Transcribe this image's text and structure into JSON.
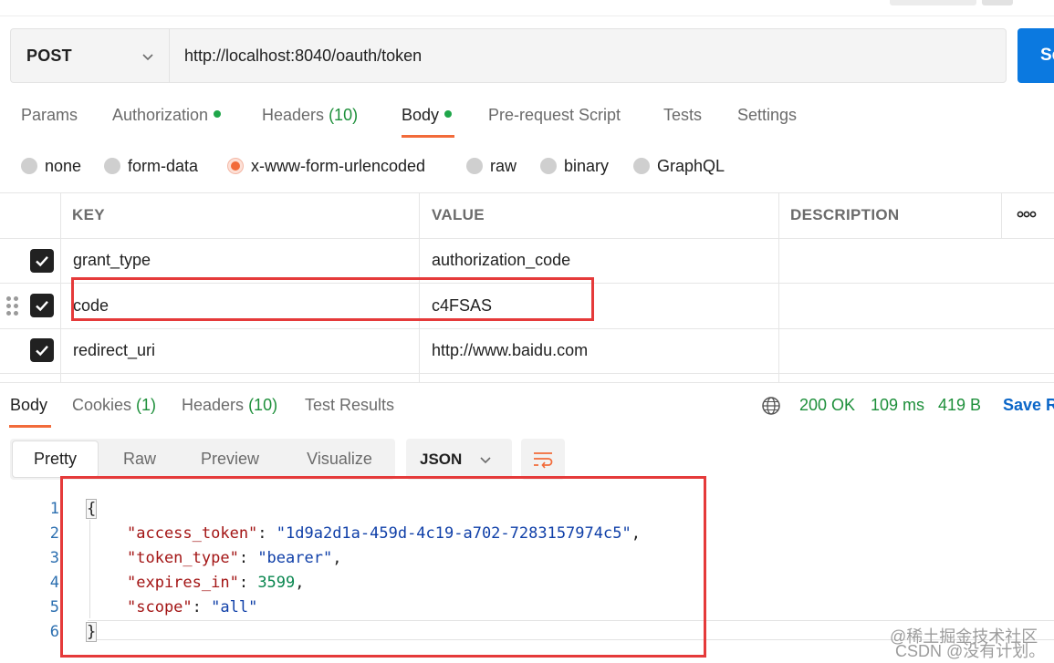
{
  "request": {
    "method": "POST",
    "url": "http://localhost:8040/oauth/token",
    "send_label": "Se"
  },
  "request_tabs": [
    {
      "label": "Params"
    },
    {
      "label": "Authorization"
    },
    {
      "label": "Headers",
      "count": "(10)"
    },
    {
      "label": "Body"
    },
    {
      "label": "Pre-request Script"
    },
    {
      "label": "Tests"
    },
    {
      "label": "Settings"
    }
  ],
  "body_types": [
    {
      "label": "none",
      "selected": false
    },
    {
      "label": "form-data",
      "selected": false
    },
    {
      "label": "x-www-form-urlencoded",
      "selected": true
    },
    {
      "label": "raw",
      "selected": false
    },
    {
      "label": "binary",
      "selected": false
    },
    {
      "label": "GraphQL",
      "selected": false
    }
  ],
  "params_table": {
    "headers": [
      "KEY",
      "VALUE",
      "DESCRIPTION"
    ],
    "rows": [
      {
        "key": "grant_type",
        "value": "authorization_code",
        "checked": true
      },
      {
        "key": "code",
        "value": "c4FSAS",
        "checked": true
      },
      {
        "key": "redirect_uri",
        "value": "http://www.baidu.com",
        "checked": true
      }
    ]
  },
  "response_tabs": [
    {
      "label": "Body"
    },
    {
      "label": "Cookies",
      "count": "(1)"
    },
    {
      "label": "Headers",
      "count": "(10)"
    },
    {
      "label": "Test Results"
    }
  ],
  "response_status": {
    "status": "200 OK",
    "time": "109 ms",
    "size": "419 B",
    "save_label": "Save R"
  },
  "view_modes": [
    "Pretty",
    "Raw",
    "Preview",
    "Visualize"
  ],
  "format": "JSON",
  "response_json": {
    "line_numbers": [
      "1",
      "2",
      "3",
      "4",
      "5",
      "6"
    ],
    "open_brace": "{",
    "close_brace": "}",
    "fields": [
      {
        "key": "\"access_token\"",
        "value": "\"1d9a2d1a-459d-4c19-a702-7283157974c5\"",
        "type": "string",
        "comma": ","
      },
      {
        "key": "\"token_type\"",
        "value": "\"bearer\"",
        "type": "string",
        "comma": ","
      },
      {
        "key": "\"expires_in\"",
        "value": "3599",
        "type": "number",
        "comma": ","
      },
      {
        "key": "\"scope\"",
        "value": "\"all\"",
        "type": "string",
        "comma": ""
      }
    ]
  },
  "watermark": {
    "line1": "@稀土掘金技术社区",
    "line2": "CSDN @没有计划。"
  },
  "colors": {
    "accent": "#f26b3a",
    "send": "#0b79e0",
    "status_ok": "#1d8f3a",
    "highlight_box": "#e53a3a"
  }
}
